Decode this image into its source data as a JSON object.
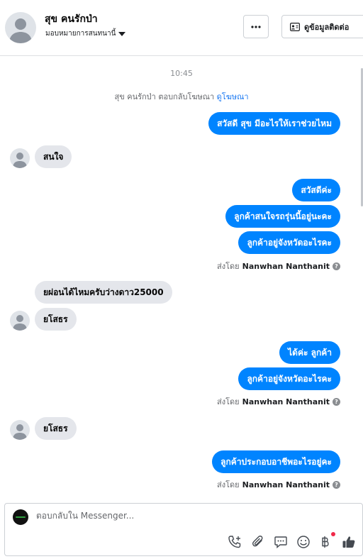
{
  "header": {
    "contact_name": "สุข คนรักป่า",
    "assign_label": "มอบหมายการสนทนานี้",
    "more_label": "···",
    "view_contact_label": "ดูข้อมูลติดต่อ"
  },
  "chat": {
    "timestamp": "10:45",
    "system_text": "สุข คนรักป่า ตอบกลับโฆษณา",
    "system_link": "ดูโฆษณา",
    "messages": [
      {
        "text": "สวัสดี สุข มีอะไรให้เราช่วยไหม"
      },
      {
        "text": "สนใจ"
      },
      {
        "text": "สวัสดีค่ะ"
      },
      {
        "text": "ลูกค้าสนใจรถรุ่นนี้อยู่นะคะ"
      },
      {
        "text": "ลูกค้าอยู่จังหวัดอะไรคะ"
      },
      {
        "text": "ยผ่อนได้ไหมครับว่างดาว25000"
      },
      {
        "text": "ยโสธร"
      },
      {
        "text": "ได้ค่ะ ลูกค้า"
      },
      {
        "text": "ลูกค้าอยู่จังหวัดอะไรคะ"
      },
      {
        "text": "ยโสธร"
      },
      {
        "text": "ลูกค้าประกอบอาชีพอะไรอยู่คะ"
      }
    ],
    "sent_by_prefix": "ส่งโดย",
    "sent_by_name": "Nanwhan Nanthanit",
    "help_glyph": "?"
  },
  "composer": {
    "placeholder": "ตอบกลับใน Messenger..."
  },
  "icons": {
    "call": "phone-plus-icon",
    "attach": "paperclip-icon",
    "saved_replies": "speech-bubble-icon",
    "emoji": "smiley-icon",
    "payment": "baht-icon",
    "like": "thumbs-up-icon"
  },
  "colors": {
    "outgoing_bubble": "#0084ff",
    "incoming_bubble": "#e4e6eb",
    "link": "#1877f2",
    "notification_dot": "#f02849"
  }
}
